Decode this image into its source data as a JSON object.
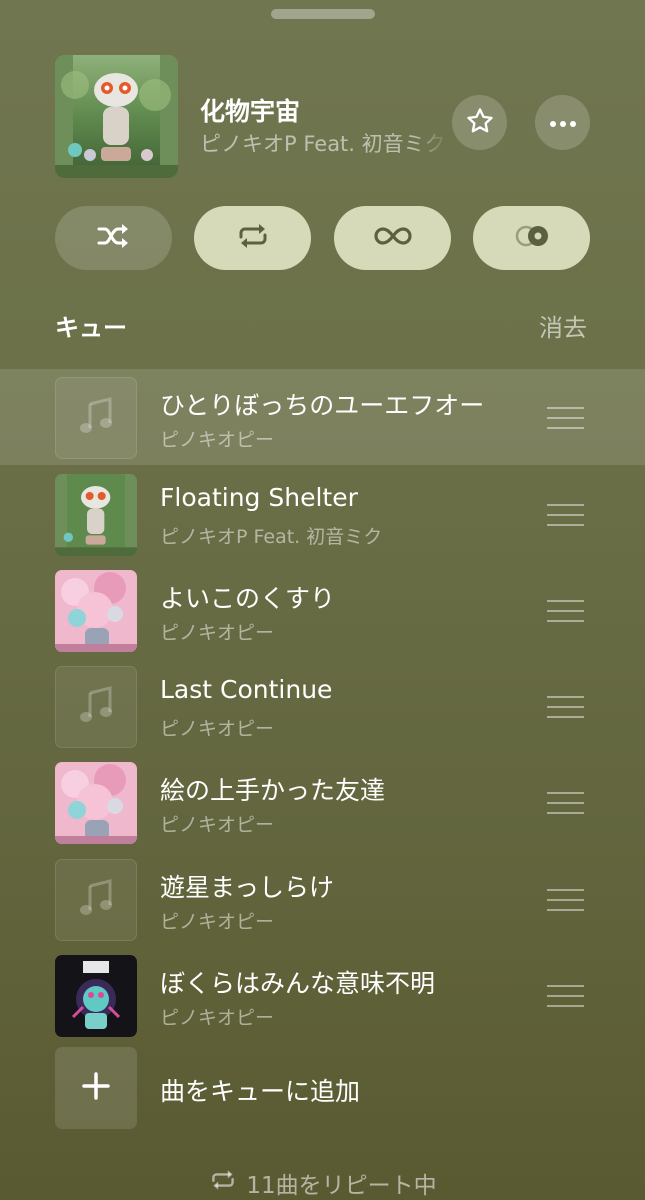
{
  "now_playing": {
    "title": "化物宇宙",
    "artist": "ピノキオP Feat. 初音ミク"
  },
  "mode_buttons": [
    {
      "name": "shuffle",
      "icon": "shuffle-icon",
      "active": false
    },
    {
      "name": "repeat",
      "icon": "repeat-icon",
      "active": true
    },
    {
      "name": "autoplay",
      "icon": "infinity-icon",
      "active": true
    },
    {
      "name": "crossfade",
      "icon": "crossfade-icon",
      "active": true
    }
  ],
  "queue": {
    "title": "キュー",
    "clear_label": "消去",
    "items": [
      {
        "title": "ひとりぼっちのユーエフオー",
        "artist": "ピノキオピー",
        "art": "placeholder"
      },
      {
        "title": "Floating Shelter",
        "artist": "ピノキオP Feat. 初音ミク",
        "art": "green"
      },
      {
        "title": "よいこのくすり",
        "artist": "ピノキオピー",
        "art": "pink"
      },
      {
        "title": "Last Continue",
        "artist": "ピノキオピー",
        "art": "placeholder"
      },
      {
        "title": "絵の上手かった友達",
        "artist": "ピノキオピー",
        "art": "pink"
      },
      {
        "title": "遊星まっしらけ",
        "artist": "ピノキオピー",
        "art": "placeholder"
      },
      {
        "title": "ぼくらはみんな意味不明",
        "artist": "ピノキオピー",
        "art": "dark"
      }
    ],
    "add_label": "曲をキューに追加"
  },
  "footer": {
    "repeat_text": "11曲をリピート中"
  },
  "colors": {
    "active_button": "#d7dab8",
    "icon_on_active": "#5b6040"
  }
}
